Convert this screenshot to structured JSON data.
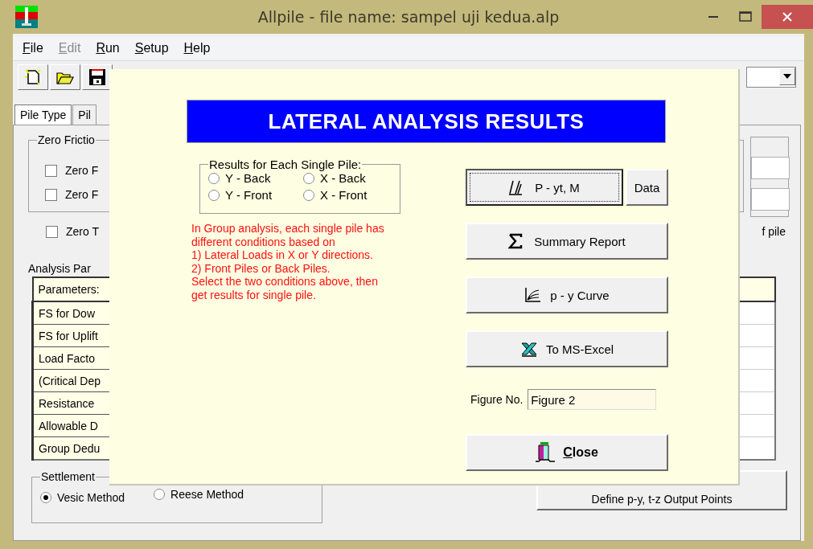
{
  "window": {
    "title": "Allpile - file name: sampel uji kedua.alp"
  },
  "menu": [
    {
      "label": "File",
      "disabled": false
    },
    {
      "label": "Edit",
      "disabled": true
    },
    {
      "label": "Run",
      "disabled": false
    },
    {
      "label": "Setup",
      "disabled": false
    },
    {
      "label": "Help",
      "disabled": false
    }
  ],
  "toolbar": [
    {
      "kind": "new"
    },
    {
      "kind": "open"
    },
    {
      "kind": "save"
    }
  ],
  "tabs": [
    {
      "label": "Pile Type",
      "selected": true
    },
    {
      "label": "Pil",
      "selected": false
    }
  ],
  "zero_friction": {
    "title": "Zero Frictio",
    "options": [
      {
        "label": "Zero F",
        "checked": false
      },
      {
        "label": "Zero F",
        "checked": false
      }
    ]
  },
  "zero_t": {
    "label": "Zero T",
    "checked": false
  },
  "right_text": "f pile",
  "analysis_parameters": {
    "title": "Analysis Par",
    "rows": [
      "Parameters:",
      "FS for Dow",
      "FS for Uplift",
      "Load Facto",
      "(Critical Dep",
      "Resistance",
      "Allowable D",
      "Group Dedu"
    ]
  },
  "settlement": {
    "title": "Settlement",
    "options": [
      {
        "label": "Vesic Method",
        "selected": true
      },
      {
        "label": "Reese Method",
        "selected": false
      }
    ]
  },
  "define_button": "Define p-y, t-z Output Points",
  "dialog": {
    "title": "LATERAL ANALYSIS RESULTS",
    "single_pile": {
      "title": "Results for Each Single Pile:",
      "options": [
        {
          "label": "Y - Back",
          "selected": false
        },
        {
          "label": "X - Back",
          "selected": false
        },
        {
          "label": "Y - Front",
          "selected": false
        },
        {
          "label": "X - Front",
          "selected": false
        }
      ]
    },
    "note": "In Group analysis, each single pile has\ndifferent conditions based on\n1) Lateral Loads in X or Y directions.\n2) Front Piles or Back Piles.\nSelect the two conditions above, then\nget results for single pile.",
    "buttons": [
      {
        "kind": "pyt",
        "label": "P - yt, M",
        "focused": true
      },
      {
        "kind": "data",
        "label": "Data",
        "focused": false
      },
      {
        "kind": "summary",
        "label": "Summary Report",
        "focused": false
      },
      {
        "kind": "curve",
        "label": "p - y  Curve",
        "focused": false
      },
      {
        "kind": "excel",
        "label": "To MS-Excel",
        "focused": false
      }
    ],
    "figure": {
      "label": "Figure No.",
      "value": "Figure 2"
    },
    "close_button": "Close"
  }
}
